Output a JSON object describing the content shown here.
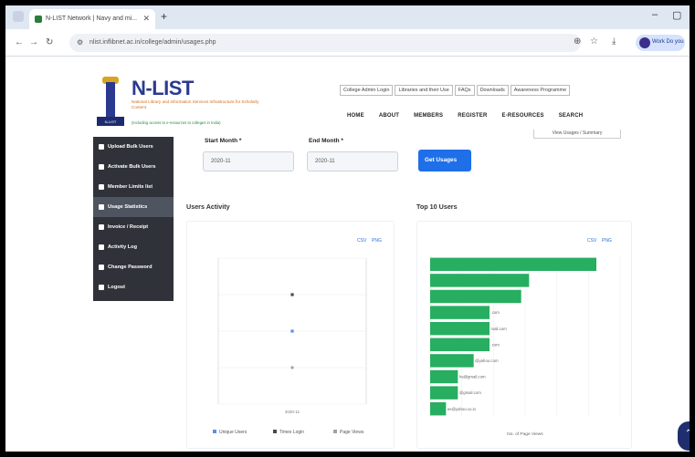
{
  "browser": {
    "tab_title": "N-LIST Network | Navy and mi...",
    "url": "nlist.inflibnet.ac.in/college/admin/usages.php",
    "profile_label": "Work Do you"
  },
  "site": {
    "brand": "N-LIST",
    "tagline": "National Library and Information Services Infrastructure for Scholarly Content",
    "tagline2": "(Including access to e-resources to colleges in India)",
    "logo_text": "N-LIST",
    "top_links": [
      "College Admin Login",
      "Libraries and their Use",
      "FAQs",
      "Downloads",
      "Awareness Programme"
    ],
    "nav": [
      "HOME",
      "ABOUT",
      "MEMBERS",
      "REGISTER",
      "E-RESOURCES",
      "SEARCH"
    ]
  },
  "sidebar": {
    "items": [
      {
        "label": "Upload Bulk Users"
      },
      {
        "label": "Activate Bulk Users"
      },
      {
        "label": "Member Limits list"
      },
      {
        "label": "Usage Statistics"
      },
      {
        "label": "Invoice / Receipt"
      },
      {
        "label": "Activity Log"
      },
      {
        "label": "Change Password"
      },
      {
        "label": "Logout"
      }
    ],
    "active_index": 3
  },
  "filters": {
    "start_label": "Start Month *",
    "start_value": "2020-11",
    "end_label": "End Month *",
    "end_value": "2020-11",
    "button": "Get Usages",
    "view_link": "View Usages / Summary"
  },
  "users_activity": {
    "title": "Users Activity",
    "export_links": [
      "CSV",
      "PNG"
    ],
    "legend": [
      "Unique Users",
      "Times Login",
      "Page Views"
    ]
  },
  "top_users": {
    "title": "Top 10 Users",
    "export_links": [
      "CSV",
      "PNG"
    ],
    "xlabel": "No. of Page Views"
  },
  "chart_data": [
    {
      "type": "scatter",
      "title": "Users Activity",
      "xlabel": "",
      "ylabel": "",
      "categories": [
        "2020-11"
      ],
      "series": [
        {
          "name": "Unique Users",
          "values": [
            2
          ]
        },
        {
          "name": "Times Login",
          "values": [
            3
          ]
        },
        {
          "name": "Page Views",
          "values": [
            1
          ]
        }
      ],
      "legend_position": "bottom"
    },
    {
      "type": "bar",
      "orientation": "horizontal",
      "title": "Top 10 Users",
      "xlabel": "No. of Page Views",
      "categories": [
        "",
        "",
        "",
        ".com",
        "mail.com",
        ".com",
        "@yahoo.com",
        "ha@gmail.com",
        "@gmail.com",
        "ee@yahoo.co.in"
      ],
      "values": [
        21,
        12.5,
        11.5,
        7.5,
        7.5,
        7.5,
        5.5,
        3.5,
        3.5,
        2
      ],
      "xlim": [
        0,
        24
      ],
      "color": "#27ae60"
    }
  ]
}
